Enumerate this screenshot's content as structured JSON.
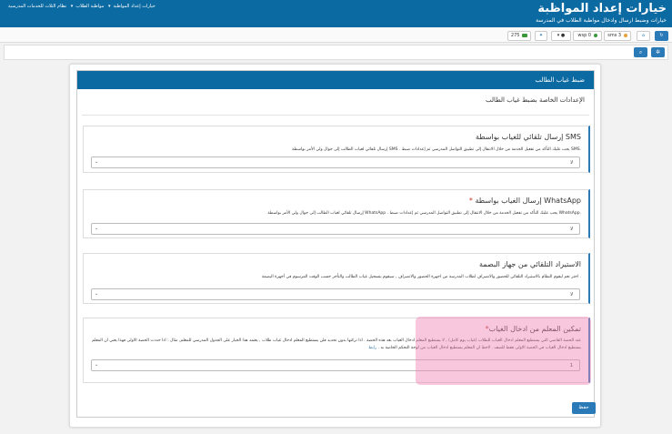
{
  "header": {
    "title": "خيارات إعداد المواظبة",
    "subtitle": "خيارات وضبط ارسال وادخال مواظبة الطلاب في المدرسة",
    "breadcrumbs": [
      "خيارات إعداد المواظبة",
      "مواظبة الطلاب",
      "نظام الثلاث للخدمات المدرسية"
    ]
  },
  "toolbar": {
    "sms_count": "275",
    "wsp_label": "wsp 0",
    "sms_label": "sms 3"
  },
  "panel": {
    "heading": "ضبط غياب الطالب",
    "section_title": "الإعدادات الخاصة بضبط غياب الطالب"
  },
  "boxes": [
    {
      "title": "إرسال تلقائي للغياب بواسطة SMS",
      "required": "",
      "desc": "إرسال تلقائي لغياب الطالب إلى جوال ولي الأمر بواسطة SMS . يجب عليك التأكد من تفعيل الخدمة من خلال الانتقال إلى تطبيق التواصل المدرسي ثم إعدادات ضبط SMS.",
      "value": "لا"
    },
    {
      "title": "إرسال الغياب بواسطة WhatsApp",
      "required": "*",
      "desc": "إرسال تلقائي لغياب الطالب إلى جوال ولي الأمر بواسطة WhatsApp . يجب عليك التأكد من تفعيل الخدمة من خلال الانتقال إلى تطبيق التواصل المدرسي ثم إعدادات ضبط WhatsApp.",
      "value": "لا"
    },
    {
      "title": "الاستيراد التلقائي من جهاز البصمة",
      "required": "",
      "desc": "اختر نعم ليقوم النظام بالاستيراد التلقائي للحضور والانصراف لطلاب المدرسة من اجهزة الحضور والانصراف , سيقوم بتسجيل غياب الطالب والتأخر حسب الوقت المرسوم في أجهزة البصمة .",
      "value": "لا"
    },
    {
      "title": "تمكين المعلم من ادخال الغياب",
      "required": "*",
      "desc": "عند الحصة القاضي التي يستطيع المعلم ادخال الغياب للطلاب (غياب يوم كامل) , لا يستطيع المعلم ادخال الغياب بعد هذه الحصة . اذا تركتها بدون تحديد فلن يستطيع المعلم ادخال غياب طلاب , يعتمد هذا الخيار على الجدول المدرسي للمعلم, مثال : اذا حددت الحصة الاولى فهذا يعني ان المعلم يستطيع ادخال الغياب في الحصة الاولى فقط للصف . لاحظ ان المعلم يستطيع ادخال الغياب من لوحة التحكم الخاصة به .",
      "link_text": "رابط",
      "value": "1"
    }
  ],
  "save_label": "حفظ"
}
